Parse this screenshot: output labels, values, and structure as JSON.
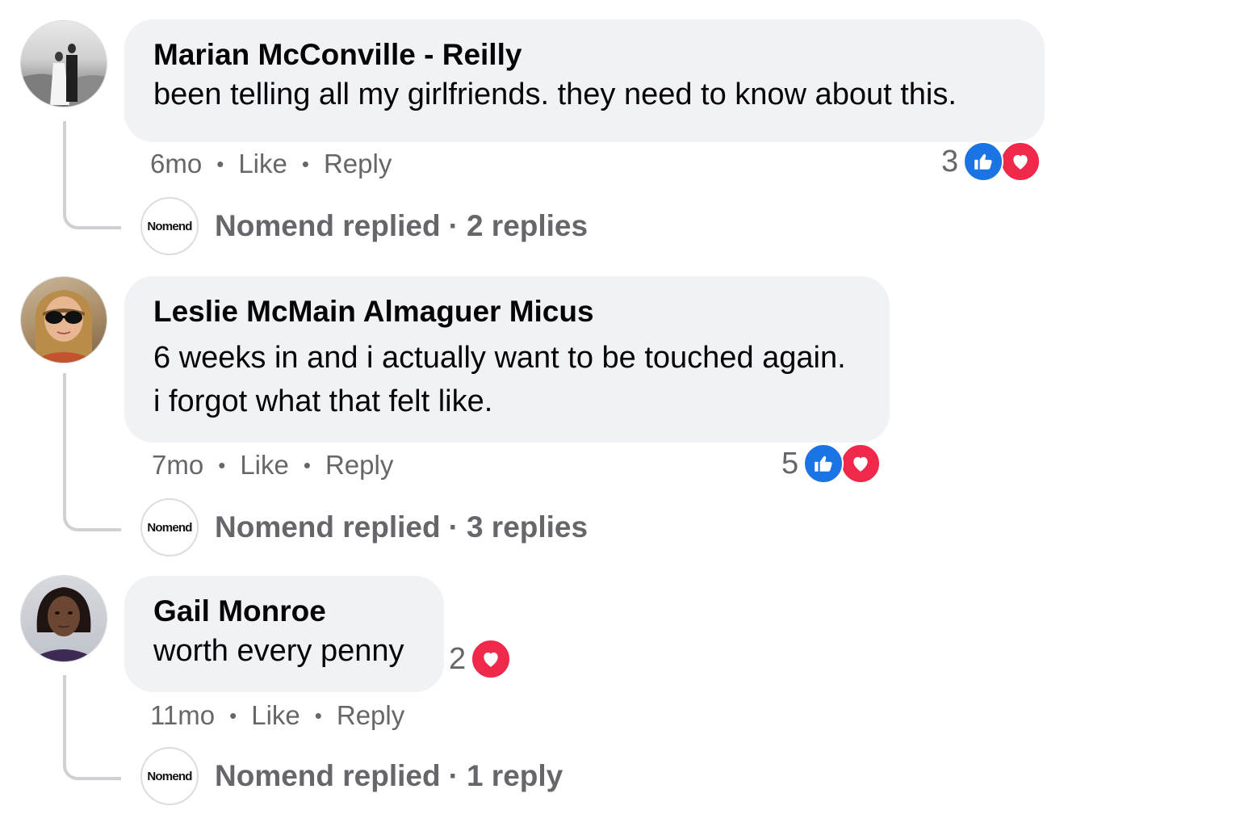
{
  "comments": [
    {
      "author": "Marian McConville - Reilly",
      "lines": [
        "been telling all my girlfriends. they need to know about this."
      ],
      "time": "6mo",
      "like_label": "Like",
      "reply_label": "Reply",
      "reaction_count": "3",
      "reactions": [
        "like-icon",
        "love-icon"
      ],
      "replied_by": "Nomend replied",
      "replies_count": "2 replies"
    },
    {
      "author": "Leslie McMain Almaguer Micus",
      "lines": [
        "6 weeks in and i actually want to be touched again.",
        "i forgot what that felt like."
      ],
      "time": "7mo",
      "like_label": "Like",
      "reply_label": "Reply",
      "reaction_count": "5",
      "reactions": [
        "like-icon",
        "love-icon"
      ],
      "replied_by": "Nomend replied",
      "replies_count": "3 replies"
    },
    {
      "author": "Gail Monroe",
      "lines": [
        "worth every penny"
      ],
      "time": "11mo",
      "like_label": "Like",
      "reply_label": "Reply",
      "reaction_count": "2",
      "reactions": [
        "love-icon"
      ],
      "replied_by": "Nomend replied",
      "replies_count": "1 reply"
    }
  ],
  "brand_avatar_text": "Nomend",
  "colors": {
    "bubble": "#f0f2f5",
    "secondary_text": "#65676b",
    "like_blue": "#1b74e4",
    "love_red": "#f02849",
    "thread_line": "#ced0d4"
  }
}
